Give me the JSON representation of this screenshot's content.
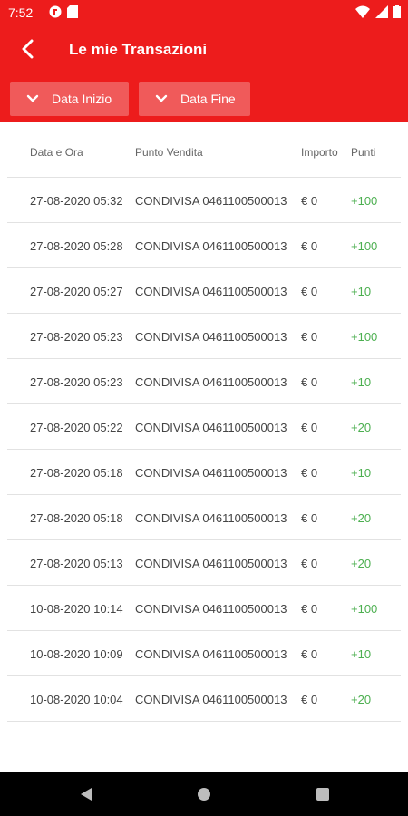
{
  "status": {
    "time": "7:52"
  },
  "header": {
    "title": "Le mie Transazioni"
  },
  "filters": {
    "start_label": "Data Inizio",
    "end_label": "Data Fine"
  },
  "table": {
    "columns": [
      "Data e Ora",
      "Punto Vendita",
      "Importo",
      "Punti"
    ],
    "rows": [
      {
        "date": "27-08-2020 05:32",
        "store": "CONDIVISA 0461100500013",
        "amount": "€ 0",
        "points": "+100"
      },
      {
        "date": "27-08-2020 05:28",
        "store": "CONDIVISA 0461100500013",
        "amount": "€ 0",
        "points": "+100"
      },
      {
        "date": "27-08-2020 05:27",
        "store": "CONDIVISA 0461100500013",
        "amount": "€ 0",
        "points": "+10"
      },
      {
        "date": "27-08-2020 05:23",
        "store": "CONDIVISA 0461100500013",
        "amount": "€ 0",
        "points": "+100"
      },
      {
        "date": "27-08-2020 05:23",
        "store": "CONDIVISA 0461100500013",
        "amount": "€ 0",
        "points": "+10"
      },
      {
        "date": "27-08-2020 05:22",
        "store": "CONDIVISA 0461100500013",
        "amount": "€ 0",
        "points": "+20"
      },
      {
        "date": "27-08-2020 05:18",
        "store": "CONDIVISA 0461100500013",
        "amount": "€ 0",
        "points": "+10"
      },
      {
        "date": "27-08-2020 05:18",
        "store": "CONDIVISA 0461100500013",
        "amount": "€ 0",
        "points": "+20"
      },
      {
        "date": "27-08-2020 05:13",
        "store": "CONDIVISA 0461100500013",
        "amount": "€ 0",
        "points": "+20"
      },
      {
        "date": "10-08-2020 10:14",
        "store": "CONDIVISA 0461100500013",
        "amount": "€ 0",
        "points": "+100"
      },
      {
        "date": "10-08-2020 10:09",
        "store": "CONDIVISA 0461100500013",
        "amount": "€ 0",
        "points": "+10"
      },
      {
        "date": "10-08-2020 10:04",
        "store": "CONDIVISA 0461100500013",
        "amount": "€ 0",
        "points": "+20"
      }
    ]
  },
  "icons": {
    "back": "back-arrow-icon",
    "filter_chevron": "chevron-down-icon",
    "status_left": [
      "notification-icon",
      "sd-card-icon"
    ],
    "status_right": [
      "wifi-icon",
      "signal-icon",
      "battery-icon"
    ],
    "nav": [
      "nav-back-icon",
      "nav-home-icon",
      "nav-recents-icon"
    ]
  },
  "colors": {
    "header": "#ed1c1c",
    "filter_button": "#f05a5a",
    "points": "#4caf50",
    "navbar": "#000000"
  }
}
